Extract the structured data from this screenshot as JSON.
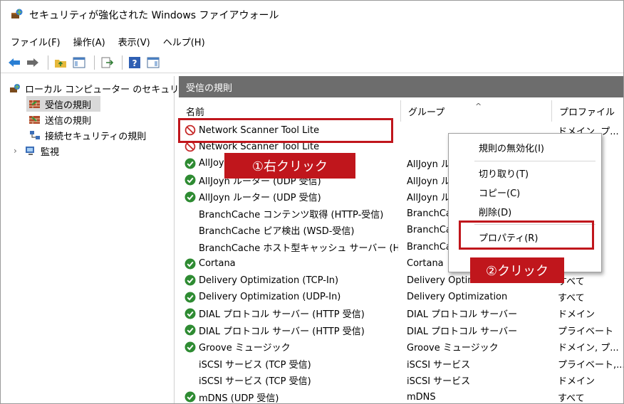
{
  "window": {
    "title": "セキュリティが強化された Windows ファイアウォール"
  },
  "menu": [
    "ファイル(F)",
    "操作(A)",
    "表示(V)",
    "ヘルプ(H)"
  ],
  "tree": {
    "root": "ローカル コンピューター のセキュリティ",
    "items": [
      "受信の規則",
      "送信の規則",
      "接続セキュリティの規則",
      "監視"
    ]
  },
  "panel": {
    "title": "受信の規則"
  },
  "columns": {
    "name": "名前",
    "group": "グループ",
    "profile": "プロファイル"
  },
  "rules": [
    {
      "name": "Network Scanner Tool Lite",
      "group": "",
      "profile": "ドメイン, プ...",
      "icon": "block"
    },
    {
      "name": "Network Scanner Tool Lite",
      "group": "",
      "profile": "",
      "icon": "block"
    },
    {
      "name": "AllJoyn",
      "group": "AllJoyn ル",
      "profile": "",
      "icon": "allow"
    },
    {
      "name": "AllJoyn ルーター (UDP 受信)",
      "group": "AllJoyn ル",
      "profile": "",
      "icon": "allow"
    },
    {
      "name": "AllJoyn ルーター (UDP 受信)",
      "group": "AllJoyn ル",
      "profile": "",
      "icon": "allow"
    },
    {
      "name": "BranchCache コンテンツ取得 (HTTP-受信)",
      "group": "BranchCa",
      "profile": "",
      "icon": "none"
    },
    {
      "name": "BranchCache ピア検出 (WSD-受信)",
      "group": "BranchCa",
      "profile": "",
      "icon": "none"
    },
    {
      "name": "BranchCache ホスト型キャッシュ サーバー (HT...",
      "group": "BranchCa",
      "profile": "",
      "icon": "none"
    },
    {
      "name": "Cortana",
      "group": "Cortana",
      "profile": "",
      "icon": "allow"
    },
    {
      "name": "Delivery Optimization (TCP-In)",
      "group": "Delivery Optimization",
      "profile": "すべて",
      "icon": "allow"
    },
    {
      "name": "Delivery Optimization (UDP-In)",
      "group": "Delivery Optimization",
      "profile": "すべて",
      "icon": "allow"
    },
    {
      "name": "DIAL プロトコル サーバー (HTTP 受信)",
      "group": "DIAL プロトコル サーバー",
      "profile": "ドメイン",
      "icon": "allow"
    },
    {
      "name": "DIAL プロトコル サーバー (HTTP 受信)",
      "group": "DIAL プロトコル サーバー",
      "profile": "プライベート",
      "icon": "allow"
    },
    {
      "name": "Groove ミュージック",
      "group": "Groove ミュージック",
      "profile": "ドメイン, プ...",
      "icon": "allow"
    },
    {
      "name": "iSCSI サービス (TCP 受信)",
      "group": "iSCSI サービス",
      "profile": "プライベート,...",
      "icon": "none"
    },
    {
      "name": "iSCSI サービス (TCP 受信)",
      "group": "iSCSI サービス",
      "profile": "ドメイン",
      "icon": "none"
    },
    {
      "name": "mDNS (UDP 受信)",
      "group": "mDNS",
      "profile": "すべて",
      "icon": "allow"
    }
  ],
  "context_menu": {
    "items": [
      "規則の無効化(I)",
      "切り取り(T)",
      "コピー(C)",
      "削除(D)",
      "プロパティ(R)"
    ]
  },
  "callouts": {
    "right_click": "①右クリック",
    "click": "②クリック"
  },
  "colors": {
    "highlight": "#c0161c",
    "panel_header": "#6d6d6d",
    "allow": "#2e8b32",
    "block": "#c62828"
  }
}
